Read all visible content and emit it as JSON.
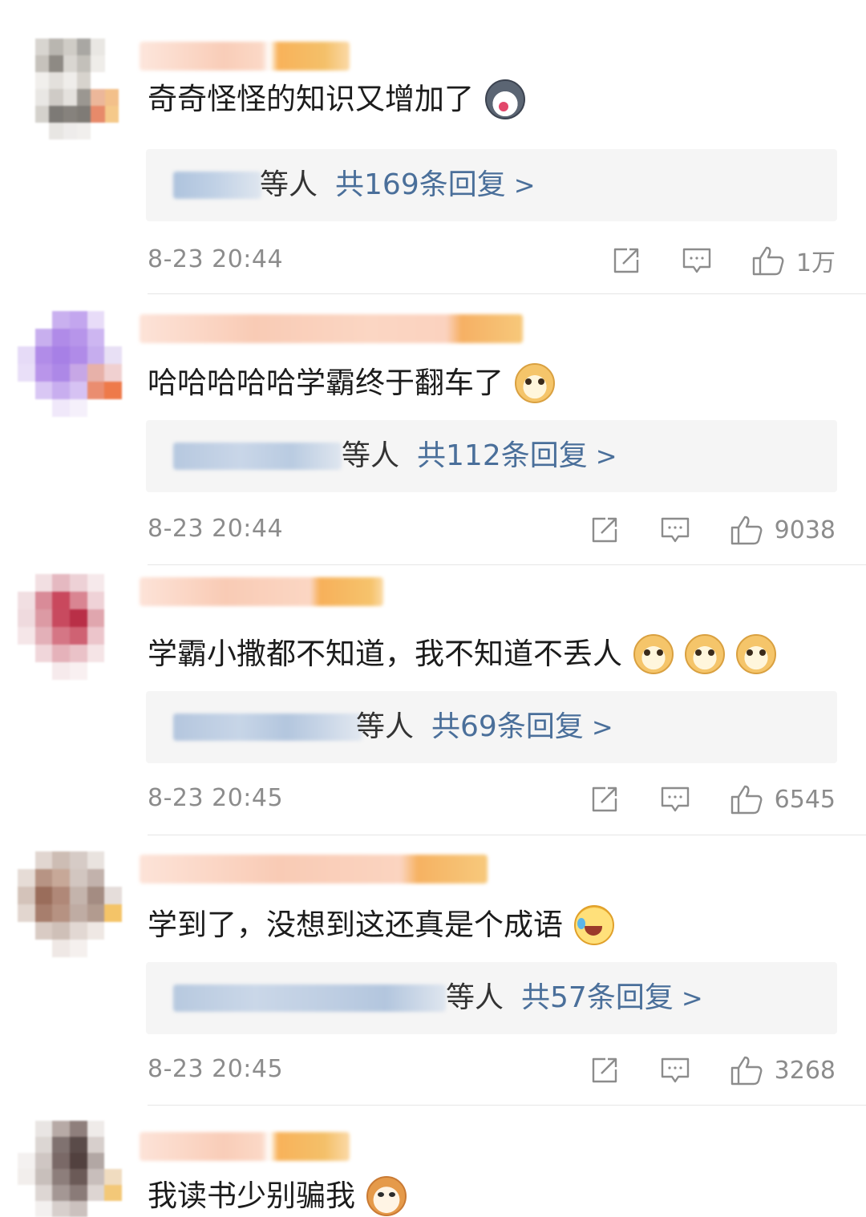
{
  "comments": [
    {
      "text": "奇奇怪怪的知识又增加了",
      "emojis": [
        "husky-emoji"
      ],
      "reply_who": "等人",
      "reply_count_label": "共169条回复",
      "reply_arrow": ">",
      "timestamp": "8-23 20:44",
      "likes": "1万"
    },
    {
      "text": "哈哈哈哈哈学霸终于翻车了",
      "emojis": [
        "doge-emoji"
      ],
      "reply_who": "等人",
      "reply_count_label": "共112条回复",
      "reply_arrow": ">",
      "timestamp": "8-23 20:44",
      "likes": "9038"
    },
    {
      "text": "学霸小撒都不知道，我不知道不丢人",
      "emojis": [
        "doge-emoji",
        "doge-emoji",
        "doge-emoji"
      ],
      "reply_who": "等人",
      "reply_count_label": "共69条回复",
      "reply_arrow": ">",
      "timestamp": "8-23 20:45",
      "likes": "6545"
    },
    {
      "text": "学到了，没想到这还真是个成语",
      "emojis": [
        "laugh-cry-emoji"
      ],
      "reply_who": "等人",
      "reply_count_label": "共57条回复",
      "reply_arrow": ">",
      "timestamp": "8-23 20:45",
      "likes": "3268"
    },
    {
      "text": "我读书少别骗我",
      "emojis": [
        "cat-emoji"
      ]
    }
  ],
  "icons": {
    "share": "share-icon",
    "reply": "comment-icon",
    "like": "thumbs-up-icon"
  },
  "colors": {
    "link": "#4a6f9a",
    "meta": "#8c8c8c",
    "reply_bg": "#f5f5f5"
  }
}
